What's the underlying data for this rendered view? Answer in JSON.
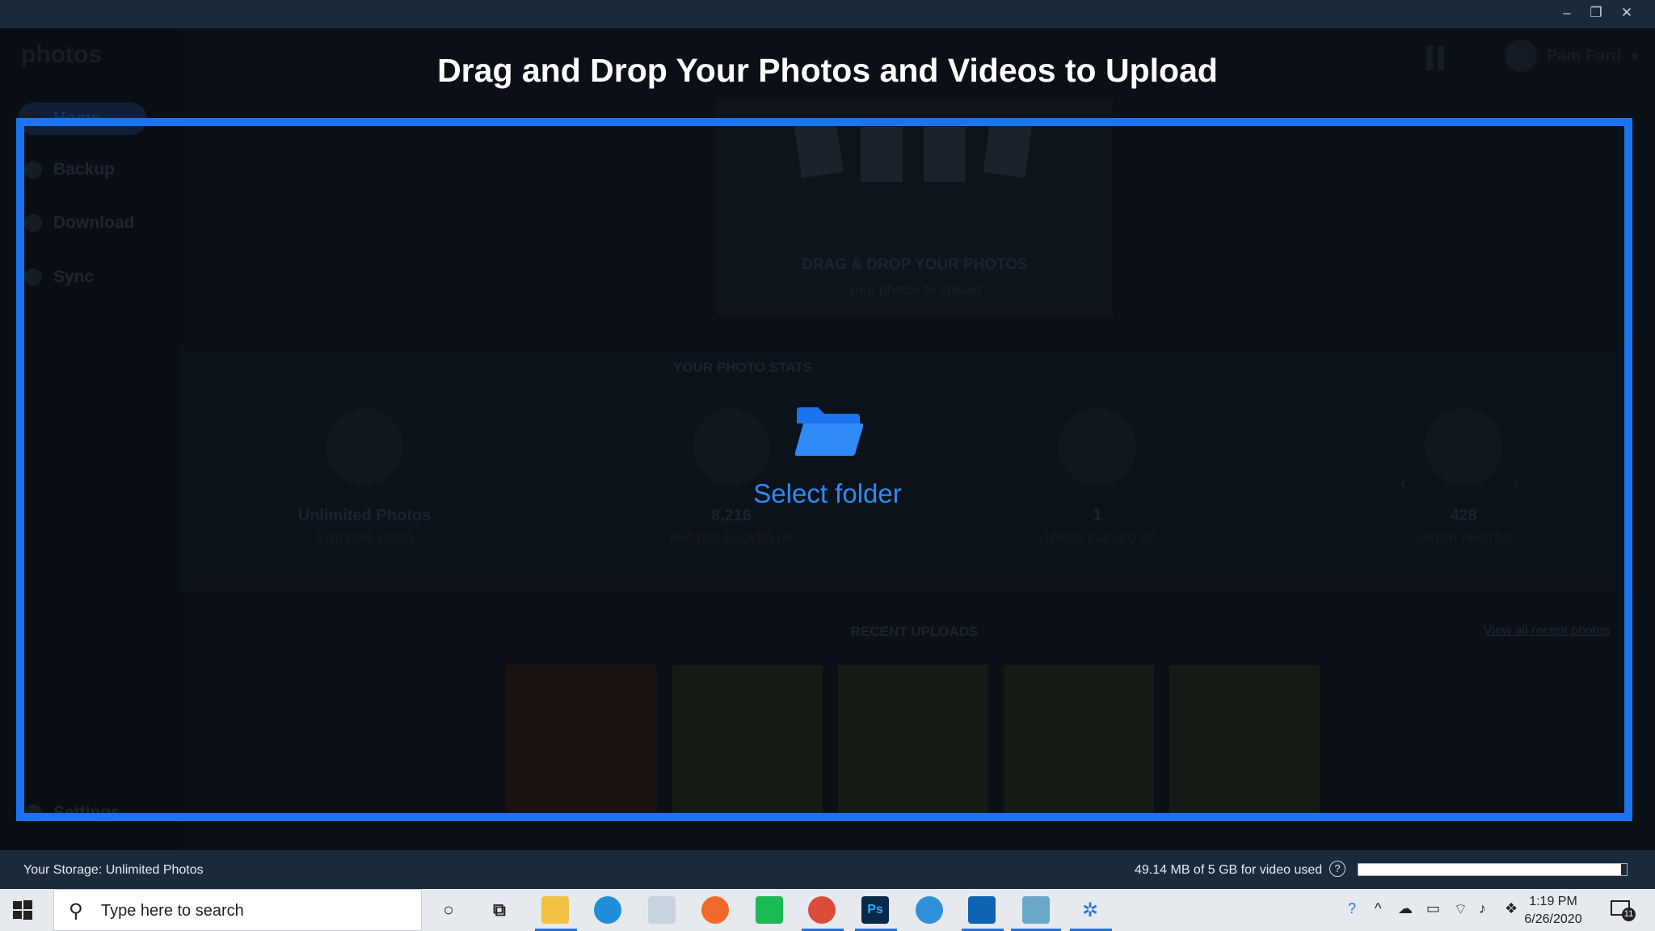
{
  "window": {
    "minimize": "–",
    "restore": "❐",
    "close": "✕"
  },
  "app": {
    "logo": "photos",
    "user_name": "Pam Ford",
    "sidebar": {
      "items": [
        {
          "label": "Home"
        },
        {
          "label": "Backup"
        },
        {
          "label": "Download"
        },
        {
          "label": "Sync"
        }
      ],
      "settings": "Settings"
    },
    "drop_card": {
      "title": "DRAG & DROP YOUR PHOTOS",
      "subtitle": "your photos to upload"
    },
    "stats": {
      "title": "YOUR PHOTO STATS",
      "items": [
        {
          "value": "Unlimited Photos",
          "label": "5 GB FOR VIDEO"
        },
        {
          "value": "8,216",
          "label": "PHOTOS BACKED UP"
        },
        {
          "value": "1",
          "label": "VIDEOS BACKED UP"
        },
        {
          "value": "428",
          "label": "WATER PHOTOS"
        }
      ]
    },
    "recent": {
      "title": "RECENT UPLOADS",
      "view_all": "View all recent photos"
    }
  },
  "overlay": {
    "title": "Drag and Drop Your Photos and Videos to Upload",
    "select_folder": "Select folder",
    "accent_color": "#1a74f0"
  },
  "status_bar": {
    "storage": "Your Storage: Unlimited Photos",
    "video_used": "49.14 MB of 5 GB for video used",
    "help": "?",
    "video_used_fraction": 0.98
  },
  "taskbar": {
    "search_placeholder": "Type here to search",
    "time": "1:19 PM",
    "date": "6/26/2020",
    "notification_count": "11"
  }
}
